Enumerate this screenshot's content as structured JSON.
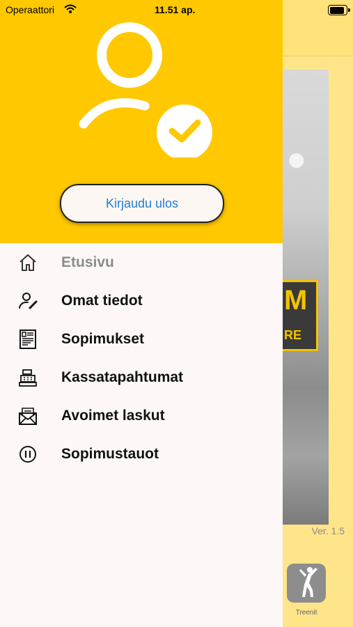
{
  "status_bar": {
    "carrier": "Operaattori",
    "time": "11.51 ap."
  },
  "drawer": {
    "logout_label": "Kirjaudu ulos",
    "menu": [
      {
        "label": "Etusivu",
        "icon": "home-icon",
        "active": true
      },
      {
        "label": "Omat tiedot",
        "icon": "user-edit-icon",
        "active": false
      },
      {
        "label": "Sopimukset",
        "icon": "contract-icon",
        "active": false
      },
      {
        "label": "Kassatapahtumat",
        "icon": "cash-register-icon",
        "active": false
      },
      {
        "label": "Avoimet laskut",
        "icon": "envelope-icon",
        "active": false
      },
      {
        "label": "Sopimustauot",
        "icon": "pause-icon",
        "active": false
      }
    ]
  },
  "background": {
    "logo_big": "M",
    "logo_small": "RE",
    "version": "Ver. 1.5",
    "tab_label": "Treenit"
  },
  "colors": {
    "accent": "#ffc800",
    "link": "#1f7fdc",
    "drawer_bg": "#fdf8f7"
  }
}
